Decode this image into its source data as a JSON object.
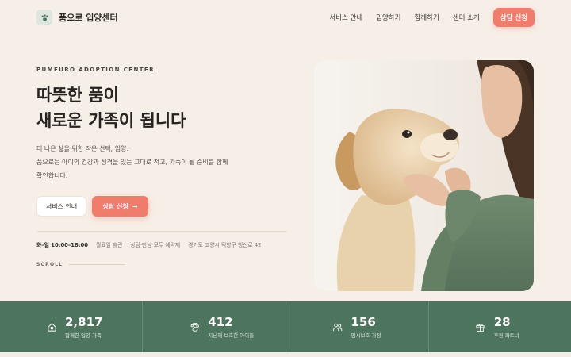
{
  "header": {
    "brand": "품으로 입양센터",
    "nav": [
      "서비스 안내",
      "입양하기",
      "함께하기",
      "센터 소개"
    ],
    "cta": "상담 신청"
  },
  "hero": {
    "eyebrow": "PUMEURO ADOPTION CENTER",
    "title_line1": "따뜻한 품이",
    "title_line2": "새로운 가족이 됩니다",
    "desc_line1": "더 나은 삶을 위한 작은 선택, 입양.",
    "desc_line2": "품으로는 아이의 건강과 성격을 있는 그대로 적고, 가족이 될 준비를 함께",
    "desc_line3": "확인합니다.",
    "btn_secondary": "서비스 안내",
    "btn_primary": "상담 신청",
    "btn_primary_arrow": "→",
    "info_hours": "화–일 10:00–18:00",
    "info_closed": "월요일 휴관",
    "info_reservation": "상담·만남 모두 예약제",
    "info_address": "경기도 고양시 덕양구 행신로 42",
    "scroll": "SCROLL"
  },
  "stats": [
    {
      "icon": "home-heart-icon",
      "value": "2,817",
      "label": "함께한 입양 가족"
    },
    {
      "icon": "paw-icon",
      "value": "412",
      "label": "지난해 보호한 아이들"
    },
    {
      "icon": "users-icon",
      "value": "156",
      "label": "임시보호 가정"
    },
    {
      "icon": "gift-icon",
      "value": "28",
      "label": "후원 파트너"
    }
  ],
  "colors": {
    "background": "#f6efe7",
    "accent": "#f07d6c",
    "stats_band": "#4d745d"
  }
}
